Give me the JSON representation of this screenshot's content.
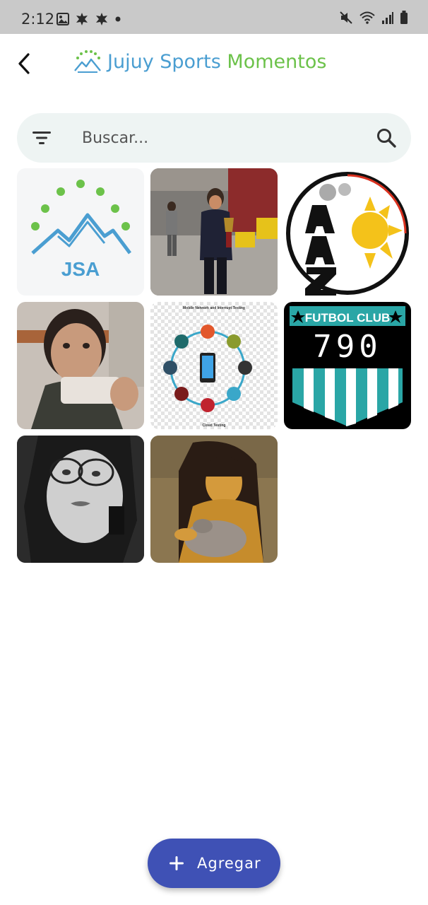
{
  "status_bar": {
    "time": "2:12",
    "left_icons": [
      "image-icon",
      "leaf-icon",
      "leaf-icon",
      "dot-icon"
    ],
    "right_icons": [
      "mute-icon",
      "wifi-icon",
      "signal-icon",
      "battery-icon"
    ]
  },
  "app_bar": {
    "back_icon": "chevron-left-icon",
    "title_part1": "Jujuy Sports",
    "title_part2": "Momentos",
    "title_color1": "#4a9ed1",
    "title_color2": "#6cc24a"
  },
  "search": {
    "placeholder": "Buscar...",
    "value": "",
    "filter_icon": "filter-icon",
    "search_icon": "search-icon"
  },
  "gallery": {
    "logo_jsa_text": "JSA",
    "diagram_title": "Mobile Network and Interrupt Testing",
    "diagram_bottom": "Cloud Testing",
    "club_title": "FUTBOL CLUB",
    "club_number": "790"
  },
  "fab": {
    "label": "Agregar",
    "icon": "plus-icon",
    "color": "#3f51b5"
  }
}
